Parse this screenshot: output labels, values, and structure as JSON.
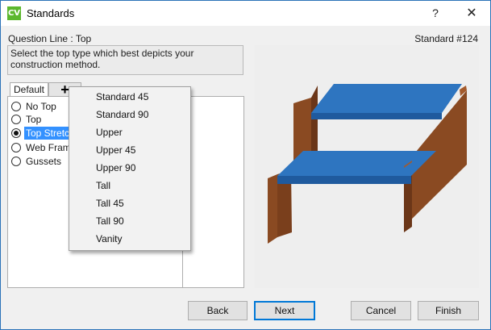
{
  "window": {
    "app_icon_text": "CV",
    "title": "Standards",
    "help_label": "?",
    "close_label": "✕"
  },
  "header": {
    "question_line": "Question Line : Top",
    "standard_number": "Standard #124"
  },
  "instructions": "Select the top type which best depicts your construction method.",
  "tabs": [
    {
      "label": "Default",
      "active": true
    },
    {
      "label": "+",
      "icon": "plus-icon"
    }
  ],
  "options": [
    {
      "label": "No Top",
      "checked": false
    },
    {
      "label": "Top",
      "checked": false
    },
    {
      "label": "Top Stretch",
      "checked": true
    },
    {
      "label": "Web Frame",
      "checked": false
    },
    {
      "label": "Gussets",
      "checked": false
    }
  ],
  "dropdown_menu": [
    "Standard 45",
    "Standard 90",
    "Upper",
    "Upper 45",
    "Upper 90",
    "Tall",
    "Tall 45",
    "Tall 90",
    "Vanity"
  ],
  "buttons": {
    "back": "Back",
    "next": "Next",
    "cancel": "Cancel",
    "finish": "Finish"
  },
  "colors": {
    "title_border": "#2b73b8",
    "selection": "#3391ff",
    "app_icon": "#5cb82e",
    "rail_top": "#2e75c0",
    "rail_front": "#1f5a9e",
    "side_panel": "#8a4a22",
    "side_panel_dark": "#6b3618"
  }
}
